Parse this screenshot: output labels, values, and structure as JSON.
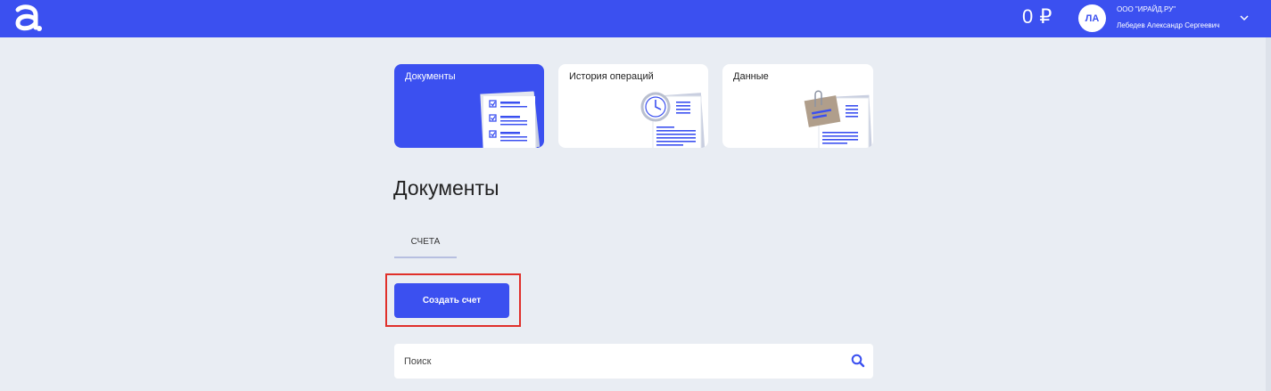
{
  "header": {
    "balance": "0 ₽",
    "avatar_initials": "ЛА",
    "company": "ООО \"ИРАЙД.РУ\"",
    "user_name": "Лебедев Александр Сергеевич",
    "brand_color": "#3b50f0"
  },
  "cards": [
    {
      "label": "Документы",
      "active": true,
      "icon": "documents-checklist-icon"
    },
    {
      "label": "История операций",
      "active": false,
      "icon": "clock-document-icon"
    },
    {
      "label": "Данные",
      "active": false,
      "icon": "paperclip-document-icon"
    }
  ],
  "main": {
    "title": "Документы",
    "tab_label": "СЧЕТА",
    "create_button_label": "Создать счет",
    "search_placeholder": "Поиск"
  }
}
